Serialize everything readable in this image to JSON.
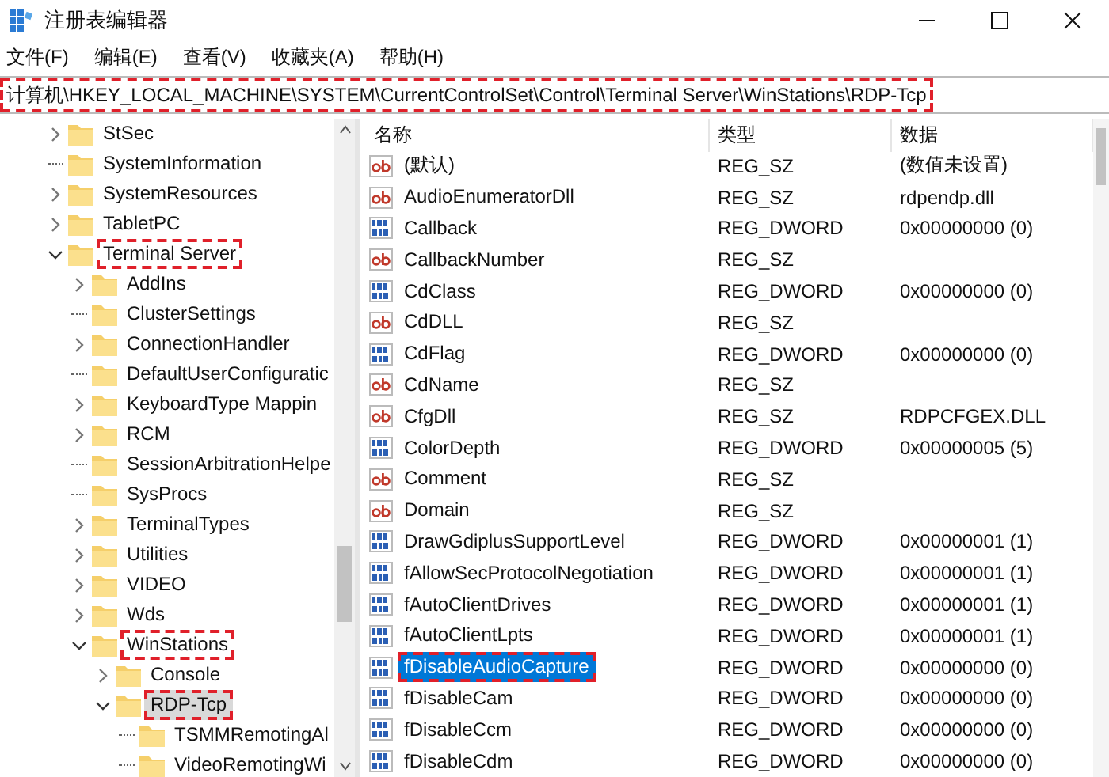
{
  "window": {
    "title": "注册表编辑器"
  },
  "menu": [
    "文件(F)",
    "编辑(E)",
    "查看(V)",
    "收藏夹(A)",
    "帮助(H)"
  ],
  "address_bar": {
    "value": "计算机\\HKEY_LOCAL_MACHINE\\SYSTEM\\CurrentControlSet\\Control\\Terminal Server\\WinStations\\RDP-Tcp",
    "annotated": true
  },
  "tree": {
    "items": [
      {
        "label": "StSec",
        "kind": "collapsed",
        "selected": false,
        "annotated": false
      },
      {
        "label": "SystemInformation",
        "selected": false,
        "annotated": false
      },
      {
        "label": "SystemResources",
        "kind": "collapsed",
        "selected": false,
        "annotated": false
      },
      {
        "label": "TabletPC",
        "kind": "collapsed",
        "selected": false,
        "annotated": false
      },
      {
        "label": "Terminal Server",
        "kind": "expanded",
        "selected": false,
        "annotated": true,
        "children": [
          {
            "label": "AddIns",
            "kind": "collapsed",
            "selected": false,
            "annotated": false
          },
          {
            "label": "ClusterSettings",
            "selected": false,
            "annotated": false
          },
          {
            "label": "ConnectionHandler",
            "kind": "collapsed",
            "selected": false,
            "annotated": false
          },
          {
            "label": "DefaultUserConfiguratic",
            "selected": false,
            "annotated": false
          },
          {
            "label": "KeyboardType Mappin",
            "kind": "collapsed",
            "selected": false,
            "annotated": false
          },
          {
            "label": "RCM",
            "kind": "collapsed",
            "selected": false,
            "annotated": false
          },
          {
            "label": "SessionArbitrationHelpe",
            "selected": false,
            "annotated": false
          },
          {
            "label": "SysProcs",
            "selected": false,
            "annotated": false
          },
          {
            "label": "TerminalTypes",
            "kind": "collapsed",
            "selected": false,
            "annotated": false
          },
          {
            "label": "Utilities",
            "kind": "collapsed",
            "selected": false,
            "annotated": false
          },
          {
            "label": "VIDEO",
            "kind": "collapsed",
            "selected": false,
            "annotated": false
          },
          {
            "label": "Wds",
            "kind": "collapsed",
            "selected": false,
            "annotated": false
          },
          {
            "label": "WinStations",
            "kind": "expanded",
            "selected": false,
            "annotated": true,
            "children": [
              {
                "label": "Console",
                "kind": "collapsed",
                "selected": false,
                "annotated": false
              },
              {
                "label": "RDP-Tcp",
                "kind": "expanded",
                "selected": true,
                "annotated": true,
                "children": [
                  {
                    "label": "TSMMRemotingAl",
                    "selected": false,
                    "annotated": false
                  },
                  {
                    "label": "VideoRemotingWi",
                    "selected": false,
                    "annotated": false
                  }
                ]
              }
            ]
          }
        ]
      }
    ]
  },
  "values_table": {
    "columns": [
      "名称",
      "类型",
      "数据"
    ],
    "rows": [
      {
        "kind": "sz",
        "name": "(默认)",
        "type": "REG_SZ",
        "data": "(数值未设置)",
        "selected": false,
        "annotated": false
      },
      {
        "kind": "sz",
        "name": "AudioEnumeratorDll",
        "type": "REG_SZ",
        "data": "rdpendp.dll",
        "selected": false,
        "annotated": false
      },
      {
        "kind": "dword",
        "name": "Callback",
        "type": "REG_DWORD",
        "data": "0x00000000 (0)",
        "selected": false,
        "annotated": false
      },
      {
        "kind": "sz",
        "name": "CallbackNumber",
        "type": "REG_SZ",
        "selected": false,
        "annotated": false
      },
      {
        "kind": "dword",
        "name": "CdClass",
        "type": "REG_DWORD",
        "data": "0x00000000 (0)",
        "selected": false,
        "annotated": false
      },
      {
        "kind": "sz",
        "name": "CdDLL",
        "type": "REG_SZ",
        "selected": false,
        "annotated": false
      },
      {
        "kind": "dword",
        "name": "CdFlag",
        "type": "REG_DWORD",
        "data": "0x00000000 (0)",
        "selected": false,
        "annotated": false
      },
      {
        "kind": "sz",
        "name": "CdName",
        "type": "REG_SZ",
        "selected": false,
        "annotated": false
      },
      {
        "kind": "sz",
        "name": "CfgDll",
        "type": "REG_SZ",
        "data": "RDPCFGEX.DLL",
        "selected": false,
        "annotated": false
      },
      {
        "kind": "dword",
        "name": "ColorDepth",
        "type": "REG_DWORD",
        "data": "0x00000005 (5)",
        "selected": false,
        "annotated": false
      },
      {
        "kind": "sz",
        "name": "Comment",
        "type": "REG_SZ",
        "selected": false,
        "annotated": false
      },
      {
        "kind": "sz",
        "name": "Domain",
        "type": "REG_SZ",
        "selected": false,
        "annotated": false
      },
      {
        "kind": "dword",
        "name": "DrawGdiplusSupportLevel",
        "type": "REG_DWORD",
        "data": "0x00000001 (1)",
        "selected": false,
        "annotated": false
      },
      {
        "kind": "dword",
        "name": "fAllowSecProtocolNegotiation",
        "type": "REG_DWORD",
        "data": "0x00000001 (1)",
        "selected": false,
        "annotated": false
      },
      {
        "kind": "dword",
        "name": "fAutoClientDrives",
        "type": "REG_DWORD",
        "data": "0x00000001 (1)",
        "selected": false,
        "annotated": false
      },
      {
        "kind": "dword",
        "name": "fAutoClientLpts",
        "type": "REG_DWORD",
        "data": "0x00000001 (1)",
        "selected": false,
        "annotated": false
      },
      {
        "kind": "dword",
        "name": "fDisableAudioCapture",
        "type": "REG_DWORD",
        "data": "0x00000000 (0)",
        "selected": true,
        "annotated": true
      },
      {
        "kind": "dword",
        "name": "fDisableCam",
        "type": "REG_DWORD",
        "data": "0x00000000 (0)",
        "selected": false,
        "annotated": false
      },
      {
        "kind": "dword",
        "name": "fDisableCcm",
        "type": "REG_DWORD",
        "data": "0x00000000 (0)",
        "selected": false,
        "annotated": false
      },
      {
        "kind": "dword",
        "name": "fDisableCdm",
        "type": "REG_DWORD",
        "data": "0x00000000 (0)",
        "selected": false,
        "annotated": false
      }
    ]
  }
}
